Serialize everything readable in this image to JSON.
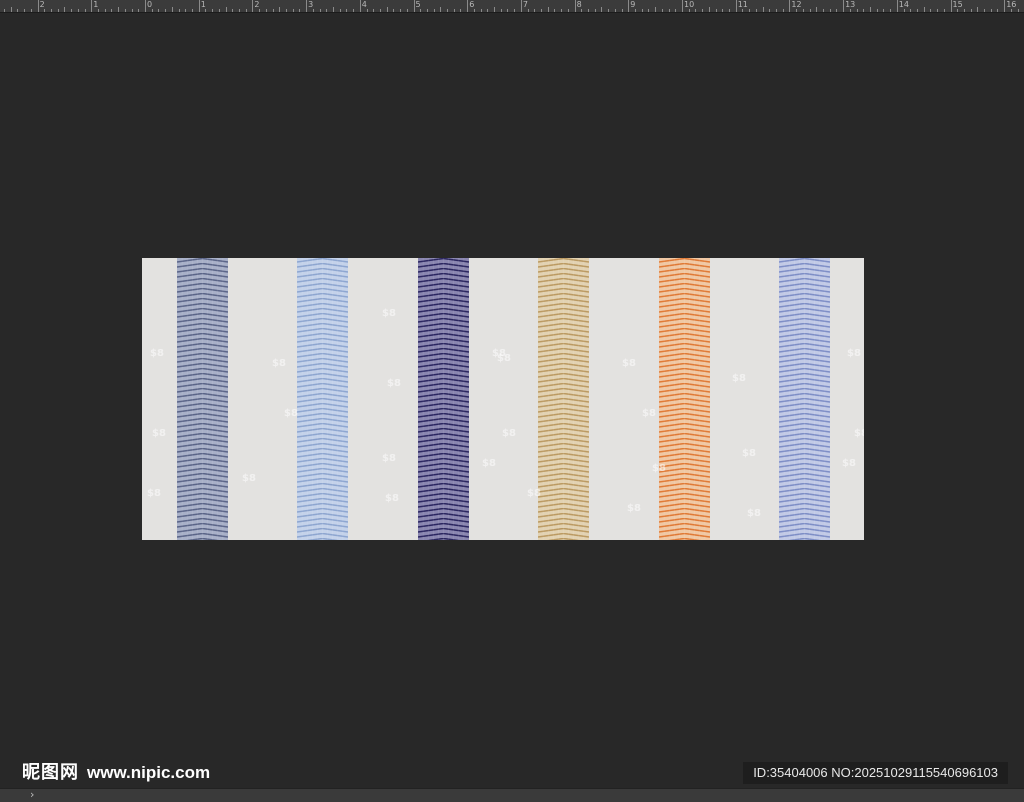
{
  "ruler": {
    "labels": [
      "2",
      "1",
      "0",
      "1",
      "2",
      "3",
      "4",
      "5",
      "6",
      "7",
      "8",
      "9",
      "10",
      "11",
      "12",
      "13",
      "14",
      "15",
      "16"
    ]
  },
  "canvas": {
    "stripes": [
      {
        "name": "slate-blue",
        "base": "#a8b0c8",
        "dark": "#5b6588"
      },
      {
        "name": "light-blue",
        "base": "#c4d2ea",
        "dark": "#8ea6d0"
      },
      {
        "name": "navy",
        "base": "#8a86b0",
        "dark": "#2b2660"
      },
      {
        "name": "tan",
        "base": "#e2d2b2",
        "dark": "#bb9a62"
      },
      {
        "name": "orange",
        "base": "#f0c8a4",
        "dark": "#e07a36"
      },
      {
        "name": "periwinkle",
        "base": "#c2cae6",
        "dark": "#7e8ec6"
      }
    ],
    "pattern_mark": "$8"
  },
  "watermark": {
    "logo_cn": "昵图网",
    "logo_url": "www.nipic.com",
    "id_text": "ID:35404006 NO:20251029115540696103"
  },
  "statusbar": {
    "arrow": "›"
  }
}
